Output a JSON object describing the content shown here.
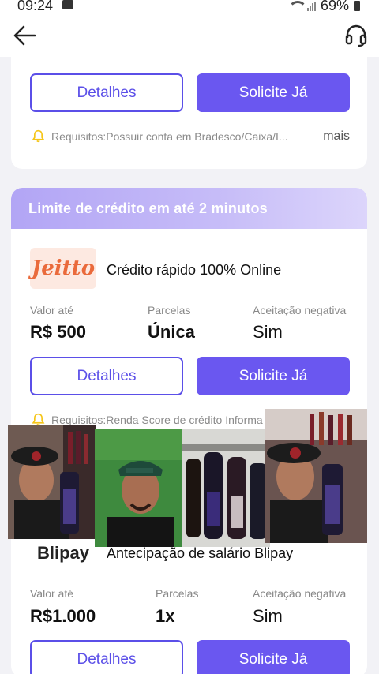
{
  "status": {
    "time": "09:24",
    "battery": "69%"
  },
  "icons": {
    "back": "arrow-left-icon",
    "support": "headset-icon",
    "bell": "bell-icon",
    "gallery": "image-icon"
  },
  "colors": {
    "accent": "#6a57f0",
    "header_gradient": "#b2a5f5",
    "bell": "#f5c518"
  },
  "card1": {
    "details_label": "Detalhes",
    "apply_label": "Solicite Já",
    "requirement": "Requisitos:Possuir conta em Bradesco/Caixa/I...",
    "more_label": "mais"
  },
  "card2": {
    "header": "Limite de crédito em até 2 minutos",
    "offer1": {
      "logo_text": "Jeitto",
      "title": "Crédito rápido 100% Online",
      "labels": [
        "Valor até",
        "Parcelas",
        "Aceitação negativa"
      ],
      "values": [
        "R$ 500",
        "Única",
        "Sim"
      ],
      "details_label": "Detalhes",
      "apply_label": "Solicite Já",
      "requirement": "Requisitos:Renda Score de crédito Informa"
    },
    "offer2": {
      "logo_text": "Blipay",
      "title": "Antecipação de salário Blipay",
      "labels": [
        "Valor até",
        "Parcelas",
        "Aceitação negativa"
      ],
      "values": [
        "R$1.000",
        "1x",
        "Sim"
      ],
      "details_label": "Detalhes",
      "apply_label": "Solicite Já"
    }
  }
}
